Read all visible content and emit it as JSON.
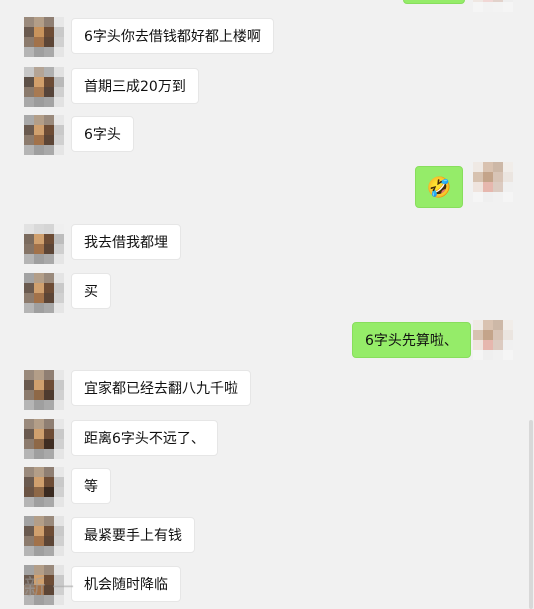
{
  "colors": {
    "background": "#f1f1f1",
    "left_bubble": "#ffffff",
    "right_bubble": "#95ec69"
  },
  "messages": [
    {
      "side": "left",
      "text": "6字头你去借钱都好都上楼啊"
    },
    {
      "side": "left",
      "text": "首期三成20万到"
    },
    {
      "side": "left",
      "text": "6字头"
    },
    {
      "side": "right",
      "text": "",
      "icon": "laughing-crying-emoji-icon"
    },
    {
      "side": "left",
      "text": "我去借我都埋"
    },
    {
      "side": "left",
      "text": "买"
    },
    {
      "side": "right",
      "text": "6字头先算啦、"
    },
    {
      "side": "left",
      "text": "宜家都已经去翻八九千啦"
    },
    {
      "side": "left",
      "text": "距离6字头不远了、"
    },
    {
      "side": "left",
      "text": "等"
    },
    {
      "side": "left",
      "text": "最紧要手上有钱"
    },
    {
      "side": "left",
      "text": "机会随时降临"
    }
  ],
  "watermark": "新一"
}
